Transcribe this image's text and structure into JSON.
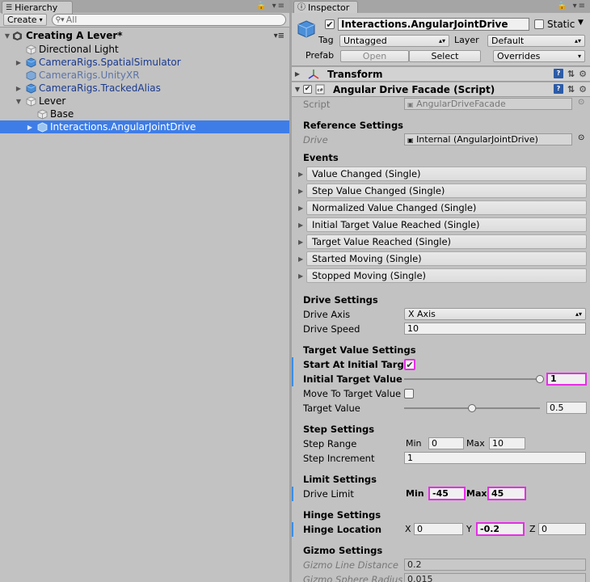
{
  "hierarchy": {
    "tab_label": "Hierarchy",
    "create_label": "Create",
    "search_placeholder": "All",
    "scene_name": "Creating A Lever*",
    "items": [
      {
        "label": "Directional Light",
        "type": "gameobject"
      },
      {
        "label": "CameraRigs.SpatialSimulator",
        "type": "prefab"
      },
      {
        "label": "CameraRigs.UnityXR",
        "type": "prefab-missing"
      },
      {
        "label": "CameraRigs.TrackedAlias",
        "type": "prefab"
      },
      {
        "label": "Lever",
        "type": "gameobject"
      },
      {
        "label": "Base",
        "type": "gameobject"
      },
      {
        "label": "Interactions.AngularJointDrive",
        "type": "prefab",
        "selected": true
      }
    ]
  },
  "inspector": {
    "tab_label": "Inspector",
    "object_name": "Interactions.AngularJointDrive",
    "static_label": "Static",
    "tag_label": "Tag",
    "tag_value": "Untagged",
    "layer_label": "Layer",
    "layer_value": "Default",
    "prefab_label": "Prefab",
    "open_label": "Open",
    "select_label": "Select",
    "overrides_label": "Overrides",
    "transform_label": "Transform",
    "component_label": "Angular Drive Facade (Script)",
    "script_label": "Script",
    "script_value": "AngularDriveFacade",
    "reference_settings": {
      "title": "Reference Settings",
      "drive_label": "Drive",
      "drive_value": "Internal (AngularJointDrive)"
    },
    "events": {
      "title": "Events",
      "items": [
        "Value Changed (Single)",
        "Step Value Changed (Single)",
        "Normalized Value Changed (Single)",
        "Initial Target Value Reached (Single)",
        "Target Value Reached (Single)",
        "Started Moving (Single)",
        "Stopped Moving (Single)"
      ]
    },
    "drive_settings": {
      "title": "Drive Settings",
      "axis_label": "Drive Axis",
      "axis_value": "X Axis",
      "speed_label": "Drive Speed",
      "speed_value": "10"
    },
    "target_value_settings": {
      "title": "Target Value Settings",
      "start_at_initial_label": "Start At Initial Target Value",
      "start_at_initial_checked": true,
      "initial_target_label": "Initial Target Value",
      "initial_target_value": "1",
      "initial_target_fraction": 1.0,
      "move_to_target_label": "Move To Target Value",
      "move_to_target_checked": false,
      "target_label": "Target Value",
      "target_value": "0.5",
      "target_fraction": 0.5
    },
    "step_settings": {
      "title": "Step Settings",
      "range_label": "Step Range",
      "min_label": "Min",
      "min_value": "0",
      "max_label": "Max",
      "max_value": "10",
      "increment_label": "Step Increment",
      "increment_value": "1"
    },
    "limit_settings": {
      "title": "Limit Settings",
      "limit_label": "Drive Limit",
      "min_label": "Min",
      "min_value": "-45",
      "max_label": "Max",
      "max_value": "45"
    },
    "hinge_settings": {
      "title": "Hinge Settings",
      "location_label": "Hinge Location",
      "x_label": "X",
      "x_value": "0",
      "y_label": "Y",
      "y_value": "-0.2",
      "z_label": "Z",
      "z_value": "0"
    },
    "gizmo_settings": {
      "title": "Gizmo Settings",
      "line_distance_label": "Gizmo Line Distance",
      "line_distance_value": "0.2",
      "sphere_radius_label": "Gizmo Sphere Radius",
      "sphere_radius_value": "0.015"
    }
  },
  "colors": {
    "selection": "#3e7de7",
    "highlight": "#e62ee6",
    "prefab_text": "#1a3a8e",
    "override_bar": "#3a8ee6"
  }
}
